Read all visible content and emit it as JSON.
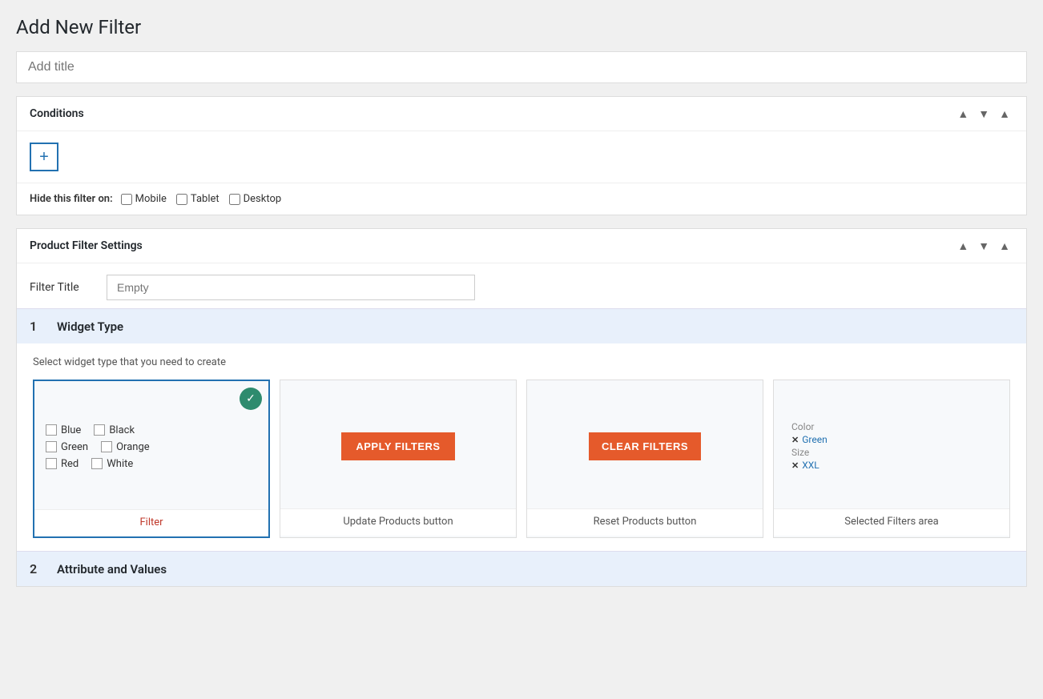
{
  "page": {
    "title": "Add New Filter",
    "title_input_placeholder": "Add title"
  },
  "conditions_card": {
    "title": "Conditions",
    "add_button_label": "+",
    "hide_filter_label": "Hide this filter on:",
    "hide_options": [
      "Mobile",
      "Tablet",
      "Desktop"
    ],
    "ctrl_up": "▲",
    "ctrl_down": "▼",
    "ctrl_collapse": "▲"
  },
  "product_filter_card": {
    "title": "Product Filter Settings",
    "filter_title_label": "Filter Title",
    "filter_title_placeholder": "Empty",
    "ctrl_up": "▲",
    "ctrl_down": "▼",
    "ctrl_collapse": "▲"
  },
  "widget_section": {
    "number": "1",
    "title": "Widget Type",
    "description": "Select widget type that you need to create"
  },
  "widget_types": [
    {
      "id": "filter",
      "label": "Filter",
      "selected": true,
      "preview_type": "checkboxes"
    },
    {
      "id": "update",
      "label": "Update Products button",
      "selected": false,
      "preview_type": "apply_btn"
    },
    {
      "id": "reset",
      "label": "Reset Products button",
      "selected": false,
      "preview_type": "clear_btn"
    },
    {
      "id": "selected",
      "label": "Selected Filters area",
      "selected": false,
      "preview_type": "selected_filters"
    }
  ],
  "filter_preview": {
    "checkboxes": [
      {
        "label": "Blue",
        "checked": false
      },
      {
        "label": "Black",
        "checked": false
      },
      {
        "label": "Green",
        "checked": false
      },
      {
        "label": "Orange",
        "checked": false
      },
      {
        "label": "Red",
        "checked": false
      },
      {
        "label": "White",
        "checked": false
      }
    ]
  },
  "apply_btn_text": "APPLY FILTERS",
  "clear_btn_text": "CLEAR FILTERS",
  "selected_filters": {
    "color_label": "Color",
    "color_value": "Green",
    "size_label": "Size",
    "size_value": "XXL"
  },
  "attribute_section": {
    "number": "2",
    "title": "Attribute and Values"
  }
}
